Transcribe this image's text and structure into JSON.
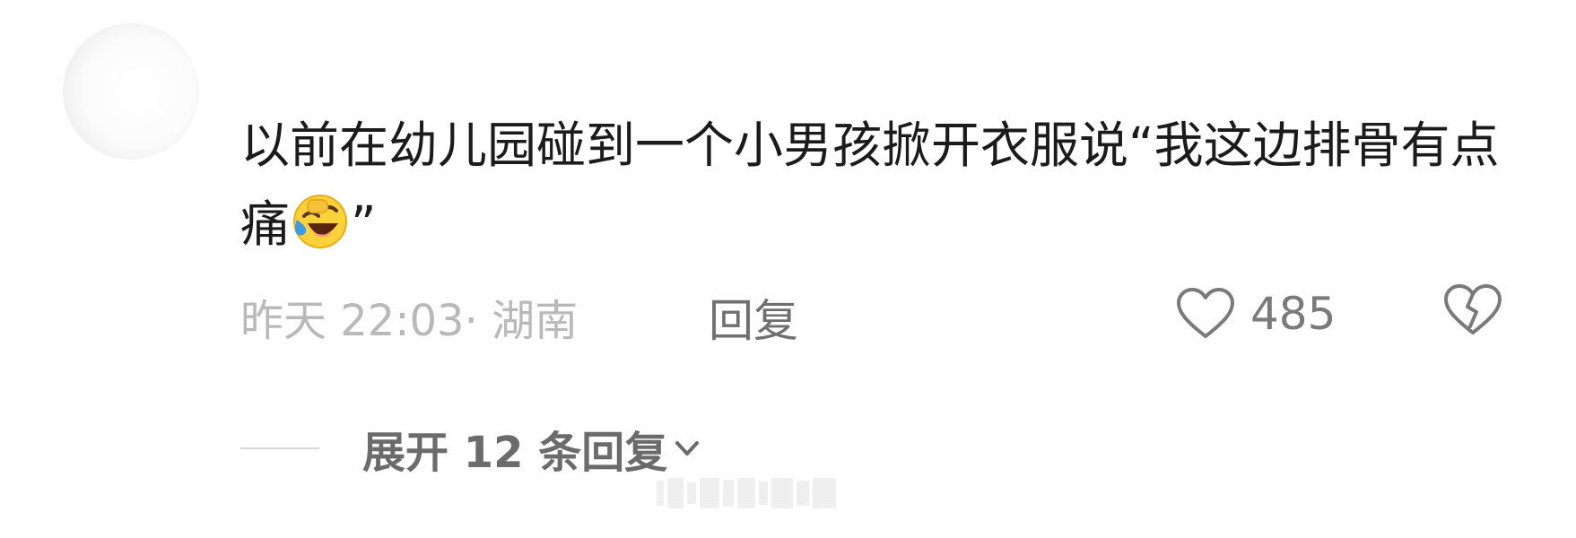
{
  "comment": {
    "text_before_emoji": "以前在幼儿园碰到一个小男孩掀开衣服说“我这边排骨有点痛",
    "emoji": "laughing-crying-emoji",
    "text_after_emoji": "”",
    "meta": "昨天 22:03· 湖南",
    "reply_label": "回复",
    "like_count": "485",
    "expand_label": "展开 12 条回复"
  },
  "colors": {
    "text": "#1b1b1b",
    "meta": "#b9b9b9",
    "action": "#6f6f6f",
    "icon": "#7a7a7a",
    "emoji_face": "#ffd23c",
    "emoji_tear": "#3b9be8"
  }
}
